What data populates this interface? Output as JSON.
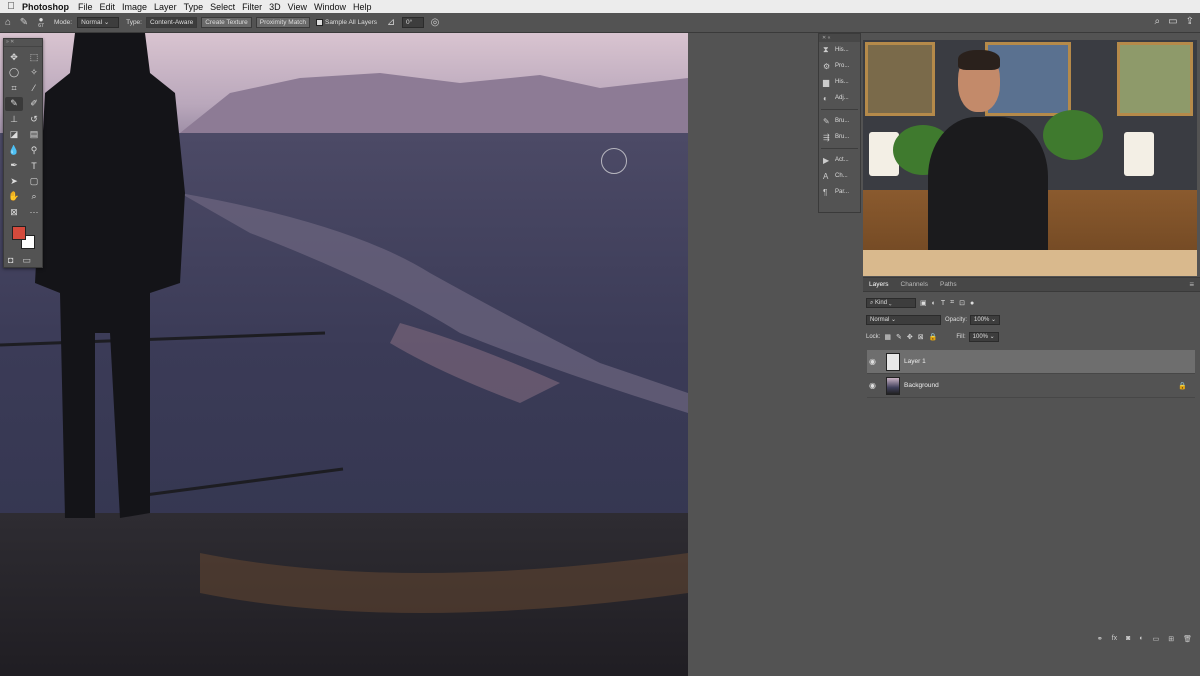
{
  "menubar": {
    "apple": "",
    "app_name": "Photoshop",
    "items": [
      "File",
      "Edit",
      "Image",
      "Layer",
      "Type",
      "Select",
      "Filter",
      "3D",
      "View",
      "Window",
      "Help"
    ]
  },
  "options": {
    "brush_size": "67",
    "mode_label": "Mode:",
    "mode_value": "Normal",
    "type_label": "Type:",
    "type_buttons": [
      "Content-Aware",
      "Create Texture",
      "Proximity Match"
    ],
    "sample_all_layers": "Sample All Layers",
    "angle": "0°"
  },
  "dock": {
    "items": [
      "His...",
      "Pro...",
      "His...",
      "Adj...",
      "Bru...",
      "Bru...",
      "Act...",
      "Ch...",
      "Par..."
    ]
  },
  "layers_panel": {
    "tabs": [
      "Layers",
      "Channels",
      "Paths"
    ],
    "filter_kind": "Kind",
    "blend_mode": "Normal",
    "opacity_label": "Opacity:",
    "opacity_value": "100%",
    "lock_label": "Lock:",
    "fill_label": "Fill:",
    "fill_value": "100%",
    "layers": [
      {
        "name": "Layer 1",
        "active": true
      },
      {
        "name": "Background",
        "active": false
      }
    ]
  },
  "colors": {
    "foreground": "#d44a3c",
    "background": "#ffffff"
  }
}
